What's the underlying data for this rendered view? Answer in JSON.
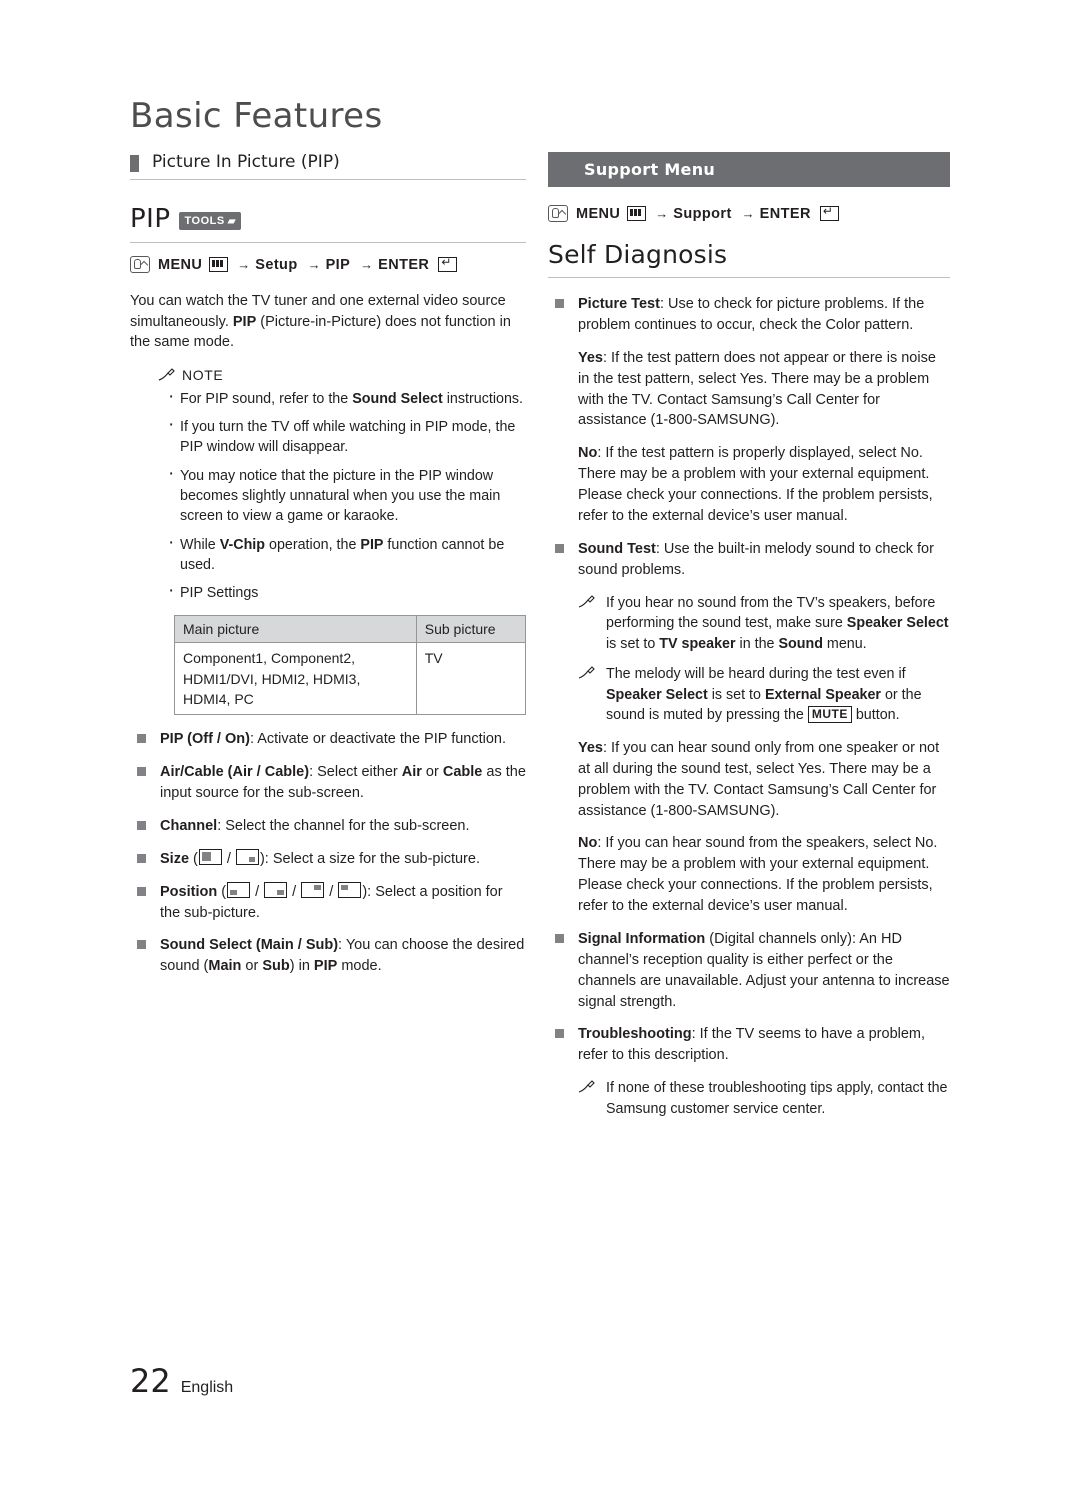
{
  "header": {
    "chapter": "Basic Features"
  },
  "left": {
    "section_title": "Picture In Picture (PIP)",
    "pip_label": "PIP",
    "tools_badge": "TOOLS",
    "menu_path": {
      "menu": "MENU",
      "arrow1": "→",
      "setup": "Setup",
      "arrow2": "→",
      "pip": "PIP",
      "arrow3": "→",
      "enter": "ENTER"
    },
    "intro": "You can watch the TV tuner and one external video source simultaneously. PIP (Picture-in-Picture) does not function in the same mode.",
    "note_label": "NOTE",
    "notes": [
      "For PIP sound, refer to the Sound Select instructions.",
      "If you turn the TV off while watching in PIP mode, the PIP window will disappear.",
      "You may notice that the picture in the PIP window becomes slightly unnatural when you use the main screen to view a game or karaoke.",
      "While V-Chip operation, the PIP function cannot be used.",
      "PIP Settings"
    ],
    "table": {
      "headers": [
        "Main picture",
        "Sub picture"
      ],
      "rows": [
        {
          "main": "Component1, Component2, HDMI1/DVI, HDMI2, HDMI3, HDMI4, PC",
          "sub": "TV"
        }
      ]
    },
    "items": [
      "PIP (Off / On): Activate or deactivate the PIP function.",
      "Air/Cable (Air / Cable): Select either Air or Cable as the input source for the sub-screen.",
      "Channel: Select the channel for the sub-screen.",
      "Size ( / ): Select a size for the sub-picture.",
      "Position ( / / / ): Select a position for the sub-picture.",
      "Sound Select (Main / Sub): You can choose the desired sound (Main or Sub) in PIP mode."
    ]
  },
  "right": {
    "banner": "Support Menu",
    "menu_path": {
      "menu": "MENU",
      "arrow1": "→",
      "support": "Support",
      "arrow2": "→",
      "enter": "ENTER"
    },
    "heading": "Self Diagnosis",
    "picture_test": "Picture Test: Use to check for picture problems. If the problem continues to occur, check the Color pattern.",
    "picture_yes": "Yes: If the test pattern does not appear or there is noise in the test pattern, select Yes. There may be a problem with the TV. Contact Samsung’s Call Center for assistance (1-800-SAMSUNG).",
    "picture_no": "No: If the test pattern is properly displayed, select No. There may be a problem with your external equipment. Please check your connections. If the problem persists, refer to the external device’s user manual.",
    "sound_test": "Sound Test: Use the built-in melody sound to check for sound problems.",
    "sound_note1": "If you hear no sound from the TV’s speakers, before performing the sound test, make sure Speaker Select is set to TV speaker in the Sound menu.",
    "sound_note2": "The melody will be heard during the test even if Speaker Select is set to External Speaker or the sound is muted by pressing the MUTE button.",
    "sound_yes": "Yes: If you can hear sound only from one speaker or not at all during the sound test, select Yes. There may be a problem with the TV. Contact Samsung’s Call Center for assistance (1-800-SAMSUNG).",
    "sound_no": "No: If you can hear sound from the speakers, select No. There may be a problem with your external equipment. Please check your connections. If the problem persists, refer to the external device’s user manual.",
    "signal_info": "Signal Information (Digital channels only): An HD channel’s reception quality is either perfect or the channels are unavailable. Adjust your antenna to increase signal strength.",
    "troubleshooting": "Troubleshooting: If the TV seems to have a problem, refer to this description.",
    "trouble_note": "If none of these troubleshooting tips apply, contact the Samsung customer service center."
  },
  "footer": {
    "page": "22",
    "language": "English"
  }
}
